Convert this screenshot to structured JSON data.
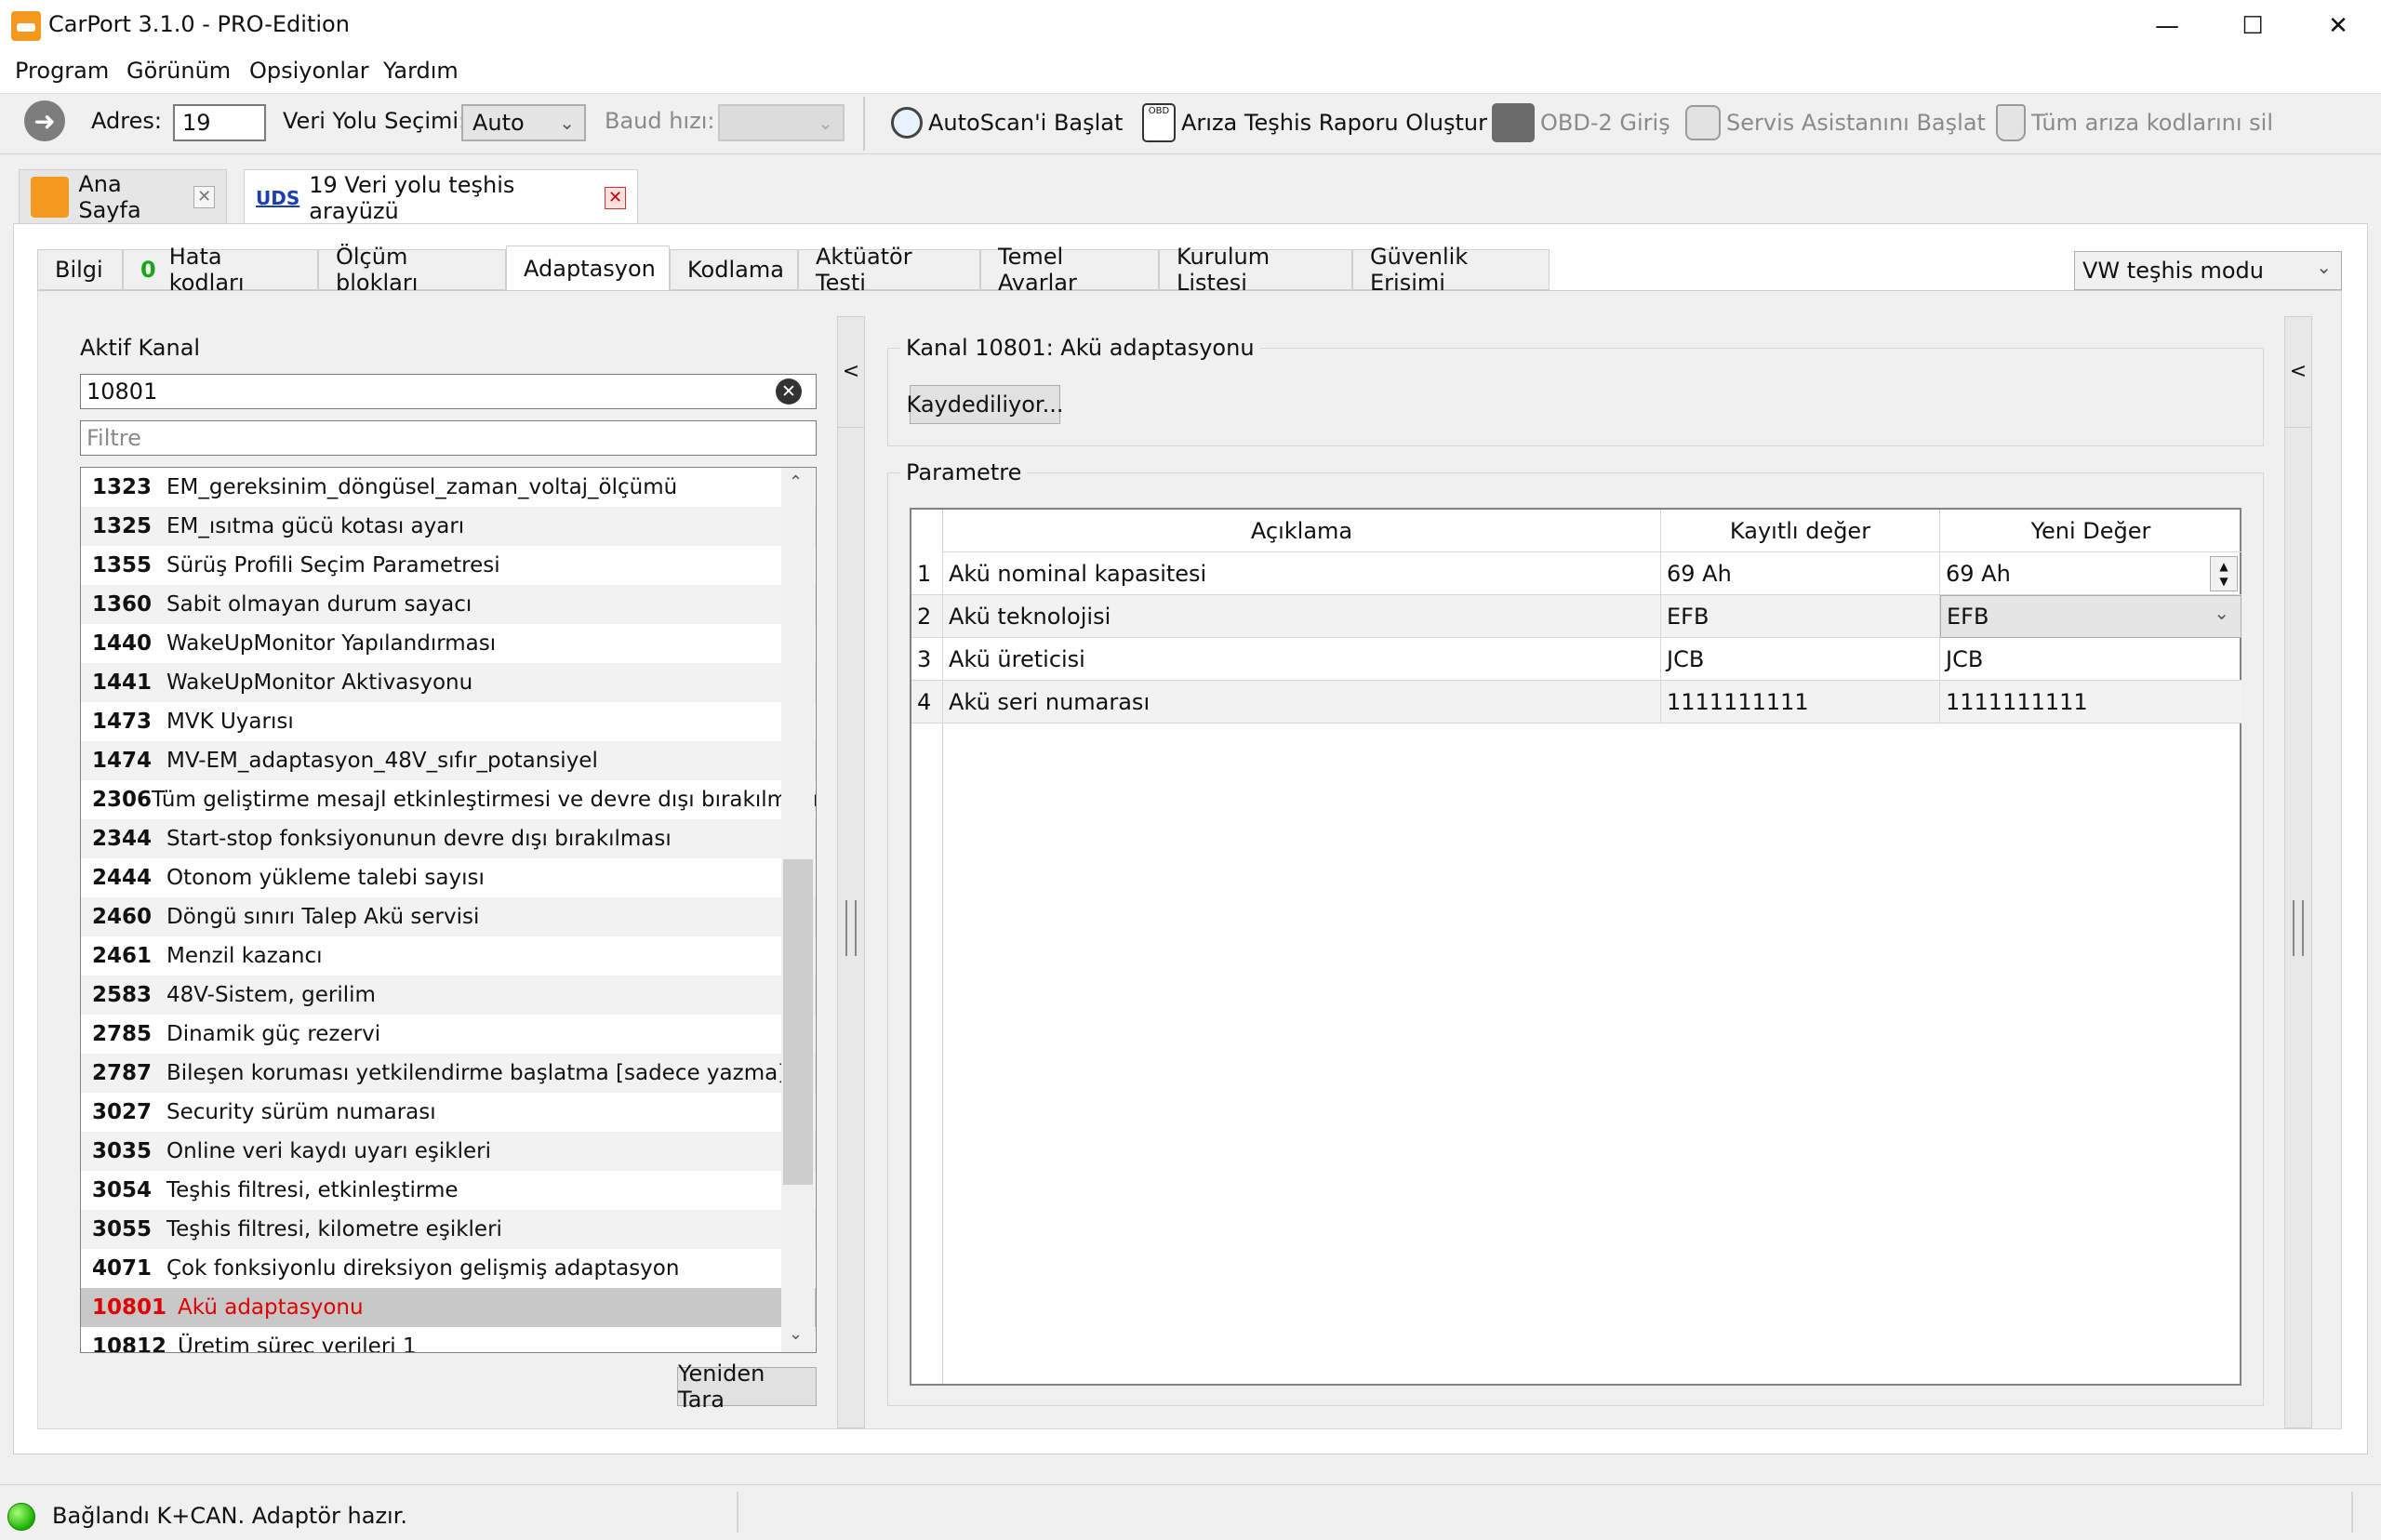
{
  "window": {
    "title": "CarPort 3.1.0 - PRO-Edition",
    "minimize": "—",
    "maximize": "☐",
    "close": "✕"
  },
  "menu": [
    "Program",
    "Görünüm",
    "Opsiyonlar",
    "Yardım"
  ],
  "toolbar": {
    "address_label": "Adres:",
    "address_value": "19",
    "bus_label": "Veri Yolu Seçimi:",
    "bus_value": "Auto",
    "baud_label": "Baud hızı:",
    "baud_value": "",
    "autoscan": "AutoScan'i Başlat",
    "report": "Arıza Teşhis Raporu Oluştur",
    "obd2": "OBD-2 Giriş",
    "service": "Servis Asistanını Başlat",
    "clear_codes": "Tüm arıza kodlarını sil"
  },
  "doc_tabs": {
    "home": "Ana Sayfa",
    "uds_badge": "UDS",
    "bus": "19 Veri yolu teşhis arayüzü"
  },
  "subtabs": {
    "info": "Bilgi",
    "fault_count": "0",
    "fault": "Hata kodları",
    "measure": "Ölçüm blokları",
    "adapt": "Adaptasyon",
    "coding": "Kodlama",
    "actuator": "Aktüatör Testi",
    "basic": "Temel Ayarlar",
    "install": "Kurulum Listesi",
    "security": "Güvenlik Erişimi"
  },
  "mode": "VW teşhis modu",
  "left": {
    "active_label": "Aktif Kanal",
    "active_value": "10801",
    "filter_placeholder": "Filtre",
    "rescan": "Yeniden Tara"
  },
  "channels": [
    {
      "num": "1323",
      "label": "EM_gereksinim_döngüsel_zaman_voltaj_ölçümü"
    },
    {
      "num": "1325",
      "label": "EM_ısıtma gücü kotası ayarı"
    },
    {
      "num": "1355",
      "label": "Sürüş Profili Seçim Parametresi"
    },
    {
      "num": "1360",
      "label": "Sabit olmayan durum sayacı"
    },
    {
      "num": "1440",
      "label": "WakeUpMonitor Yapılandırması"
    },
    {
      "num": "1441",
      "label": "WakeUpMonitor Aktivasyonu"
    },
    {
      "num": "1473",
      "label": "MVK Uyarısı"
    },
    {
      "num": "1474",
      "label": "MV-EM_adaptasyon_48V_sıfır_potansiyel"
    },
    {
      "num": "2306",
      "label": "Tüm geliştirme mesajl etkinleştirmesi ve devre dışı bırakılması"
    },
    {
      "num": "2344",
      "label": "Start-stop fonksiyonunun devre dışı bırakılması"
    },
    {
      "num": "2444",
      "label": "Otonom yükleme talebi sayısı"
    },
    {
      "num": "2460",
      "label": "Döngü sınırı Talep Akü servisi"
    },
    {
      "num": "2461",
      "label": "Menzil kazancı"
    },
    {
      "num": "2583",
      "label": "48V-Sistem, gerilim"
    },
    {
      "num": "2785",
      "label": "Dinamik güç rezervi"
    },
    {
      "num": "2787",
      "label": "Bileşen koruması yetkilendirme başlatma [sadece yazma]"
    },
    {
      "num": "3027",
      "label": "Security sürüm numarası"
    },
    {
      "num": "3035",
      "label": "Online veri kaydı uyarı eşikleri"
    },
    {
      "num": "3054",
      "label": "Teşhis filtresi, etkinleştirme"
    },
    {
      "num": "3055",
      "label": "Teşhis filtresi, kilometre eşikleri"
    },
    {
      "num": "4071",
      "label": "Çok fonksiyonlu direksiyon gelişmiş adaptasyon"
    },
    {
      "num": "10801",
      "label": "Akü adaptasyonu",
      "selected": true
    },
    {
      "num": "10812",
      "label": "Üretim süreç verileri 1"
    }
  ],
  "right": {
    "channel_title": "Kanal 10801: Akü adaptasyonu",
    "saving_button": "Kaydediliyor...",
    "param_title": "Parametre",
    "headers": {
      "desc": "Açıklama",
      "saved": "Kayıtlı değer",
      "new": "Yeni Değer"
    },
    "rows": [
      {
        "idx": "1",
        "desc": "Akü nominal kapasitesi",
        "saved": "69 Ah",
        "new": "69 Ah"
      },
      {
        "idx": "2",
        "desc": "Akü teknolojisi",
        "saved": "EFB",
        "new": "EFB"
      },
      {
        "idx": "3",
        "desc": "Akü üreticisi",
        "saved": "JCB",
        "new": "JCB"
      },
      {
        "idx": "4",
        "desc": "Akü seri numarası",
        "saved": "1111111111",
        "new": "1111111111"
      }
    ]
  },
  "collapse_glyph": "<",
  "status": "Bağlandı K+CAN. Adaptör hazır.",
  "colors": {
    "accent_orange": "#f39a1e",
    "selected_text": "#e00000",
    "status_led": "#18b000",
    "uds_blue": "#1a3fb0"
  }
}
